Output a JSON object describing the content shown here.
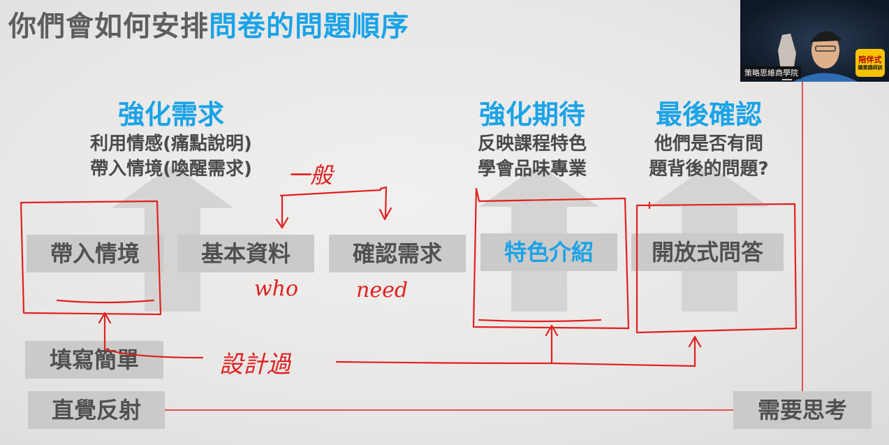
{
  "title": {
    "part1": "你們會如何安排",
    "part2": "問卷的問題順序"
  },
  "columns": [
    {
      "heading": "強化需求",
      "line1": "利用情感(痛點說明)",
      "line2": "帶入情境(喚醒需求)"
    },
    {
      "heading": "強化期待",
      "line1": "反映課程特色",
      "line2": "學會品味專業"
    },
    {
      "heading": "最後確認",
      "line1": "他們是否有問",
      "line2": "題背後的問題?"
    }
  ],
  "boxes": {
    "scenario": "帶入情境",
    "basic_info": "基本資料",
    "confirm_need": "確認需求",
    "feature_intro": "特色介紹",
    "open_qa": "開放式問答",
    "easy_fill": "填寫簡單",
    "intuitive": "直覺反射",
    "need_think": "需要思考"
  },
  "handwriting": {
    "general": "一般",
    "who": "who",
    "need": "need",
    "design": "設計過"
  },
  "webcam": {
    "channel": "策略思維商學院",
    "badge_line1": "陪伴式",
    "badge_line2": "職業講師訓"
  },
  "colors": {
    "accent_blue": "#1aa3e8",
    "ink_red": "#e02020",
    "box_gray": "#cbcac8",
    "arrow_gray": "#d5d4d2"
  }
}
